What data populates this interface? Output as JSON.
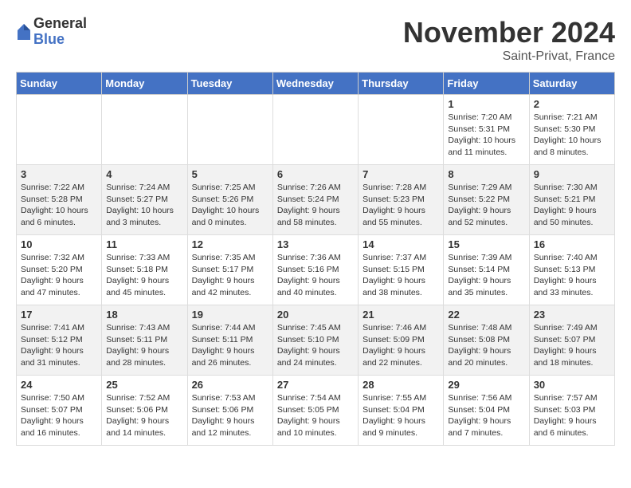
{
  "logo": {
    "general": "General",
    "blue": "Blue"
  },
  "title": "November 2024",
  "subtitle": "Saint-Privat, France",
  "days_header": [
    "Sunday",
    "Monday",
    "Tuesday",
    "Wednesday",
    "Thursday",
    "Friday",
    "Saturday"
  ],
  "weeks": [
    [
      {
        "day": "",
        "info": ""
      },
      {
        "day": "",
        "info": ""
      },
      {
        "day": "",
        "info": ""
      },
      {
        "day": "",
        "info": ""
      },
      {
        "day": "",
        "info": ""
      },
      {
        "day": "1",
        "info": "Sunrise: 7:20 AM\nSunset: 5:31 PM\nDaylight: 10 hours and 11 minutes."
      },
      {
        "day": "2",
        "info": "Sunrise: 7:21 AM\nSunset: 5:30 PM\nDaylight: 10 hours and 8 minutes."
      }
    ],
    [
      {
        "day": "3",
        "info": "Sunrise: 7:22 AM\nSunset: 5:28 PM\nDaylight: 10 hours and 6 minutes."
      },
      {
        "day": "4",
        "info": "Sunrise: 7:24 AM\nSunset: 5:27 PM\nDaylight: 10 hours and 3 minutes."
      },
      {
        "day": "5",
        "info": "Sunrise: 7:25 AM\nSunset: 5:26 PM\nDaylight: 10 hours and 0 minutes."
      },
      {
        "day": "6",
        "info": "Sunrise: 7:26 AM\nSunset: 5:24 PM\nDaylight: 9 hours and 58 minutes."
      },
      {
        "day": "7",
        "info": "Sunrise: 7:28 AM\nSunset: 5:23 PM\nDaylight: 9 hours and 55 minutes."
      },
      {
        "day": "8",
        "info": "Sunrise: 7:29 AM\nSunset: 5:22 PM\nDaylight: 9 hours and 52 minutes."
      },
      {
        "day": "9",
        "info": "Sunrise: 7:30 AM\nSunset: 5:21 PM\nDaylight: 9 hours and 50 minutes."
      }
    ],
    [
      {
        "day": "10",
        "info": "Sunrise: 7:32 AM\nSunset: 5:20 PM\nDaylight: 9 hours and 47 minutes."
      },
      {
        "day": "11",
        "info": "Sunrise: 7:33 AM\nSunset: 5:18 PM\nDaylight: 9 hours and 45 minutes."
      },
      {
        "day": "12",
        "info": "Sunrise: 7:35 AM\nSunset: 5:17 PM\nDaylight: 9 hours and 42 minutes."
      },
      {
        "day": "13",
        "info": "Sunrise: 7:36 AM\nSunset: 5:16 PM\nDaylight: 9 hours and 40 minutes."
      },
      {
        "day": "14",
        "info": "Sunrise: 7:37 AM\nSunset: 5:15 PM\nDaylight: 9 hours and 38 minutes."
      },
      {
        "day": "15",
        "info": "Sunrise: 7:39 AM\nSunset: 5:14 PM\nDaylight: 9 hours and 35 minutes."
      },
      {
        "day": "16",
        "info": "Sunrise: 7:40 AM\nSunset: 5:13 PM\nDaylight: 9 hours and 33 minutes."
      }
    ],
    [
      {
        "day": "17",
        "info": "Sunrise: 7:41 AM\nSunset: 5:12 PM\nDaylight: 9 hours and 31 minutes."
      },
      {
        "day": "18",
        "info": "Sunrise: 7:43 AM\nSunset: 5:11 PM\nDaylight: 9 hours and 28 minutes."
      },
      {
        "day": "19",
        "info": "Sunrise: 7:44 AM\nSunset: 5:11 PM\nDaylight: 9 hours and 26 minutes."
      },
      {
        "day": "20",
        "info": "Sunrise: 7:45 AM\nSunset: 5:10 PM\nDaylight: 9 hours and 24 minutes."
      },
      {
        "day": "21",
        "info": "Sunrise: 7:46 AM\nSunset: 5:09 PM\nDaylight: 9 hours and 22 minutes."
      },
      {
        "day": "22",
        "info": "Sunrise: 7:48 AM\nSunset: 5:08 PM\nDaylight: 9 hours and 20 minutes."
      },
      {
        "day": "23",
        "info": "Sunrise: 7:49 AM\nSunset: 5:07 PM\nDaylight: 9 hours and 18 minutes."
      }
    ],
    [
      {
        "day": "24",
        "info": "Sunrise: 7:50 AM\nSunset: 5:07 PM\nDaylight: 9 hours and 16 minutes."
      },
      {
        "day": "25",
        "info": "Sunrise: 7:52 AM\nSunset: 5:06 PM\nDaylight: 9 hours and 14 minutes."
      },
      {
        "day": "26",
        "info": "Sunrise: 7:53 AM\nSunset: 5:06 PM\nDaylight: 9 hours and 12 minutes."
      },
      {
        "day": "27",
        "info": "Sunrise: 7:54 AM\nSunset: 5:05 PM\nDaylight: 9 hours and 10 minutes."
      },
      {
        "day": "28",
        "info": "Sunrise: 7:55 AM\nSunset: 5:04 PM\nDaylight: 9 hours and 9 minutes."
      },
      {
        "day": "29",
        "info": "Sunrise: 7:56 AM\nSunset: 5:04 PM\nDaylight: 9 hours and 7 minutes."
      },
      {
        "day": "30",
        "info": "Sunrise: 7:57 AM\nSunset: 5:03 PM\nDaylight: 9 hours and 6 minutes."
      }
    ]
  ]
}
